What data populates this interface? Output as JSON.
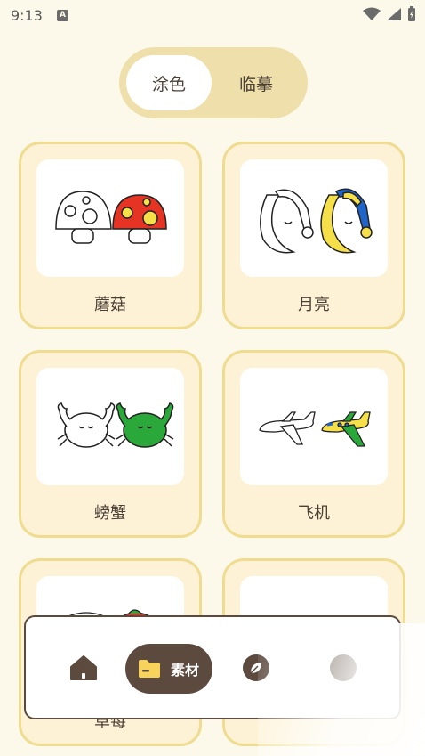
{
  "status_bar": {
    "time": "9:13",
    "notif_letter": "A"
  },
  "segmented": {
    "tabs": [
      "涂色",
      "临摹"
    ],
    "active_index": 0
  },
  "cards": [
    {
      "label": "蘑菇",
      "icon": "mushroom-drawing"
    },
    {
      "label": "月亮",
      "icon": "moon-drawing"
    },
    {
      "label": "螃蟹",
      "icon": "crab-drawing"
    },
    {
      "label": "飞机",
      "icon": "airplane-drawing"
    },
    {
      "label": "草莓",
      "icon": "strawberry-drawing"
    },
    {
      "label": "",
      "icon": "drawing"
    }
  ],
  "bottom_nav": {
    "items": [
      {
        "icon": "home-icon"
      },
      {
        "icon": "folder-icon",
        "label": "素材",
        "active": true
      },
      {
        "icon": "leaf-icon"
      },
      {
        "icon": "profile-icon"
      }
    ]
  },
  "colors": {
    "background": "#fdf9ea",
    "card_fill": "#fdf2d5",
    "card_border": "#f0dc91",
    "segment_bg": "#efdfaa",
    "nav_accent": "#5c4a3f",
    "folder_yellow": "#f7d35c"
  }
}
